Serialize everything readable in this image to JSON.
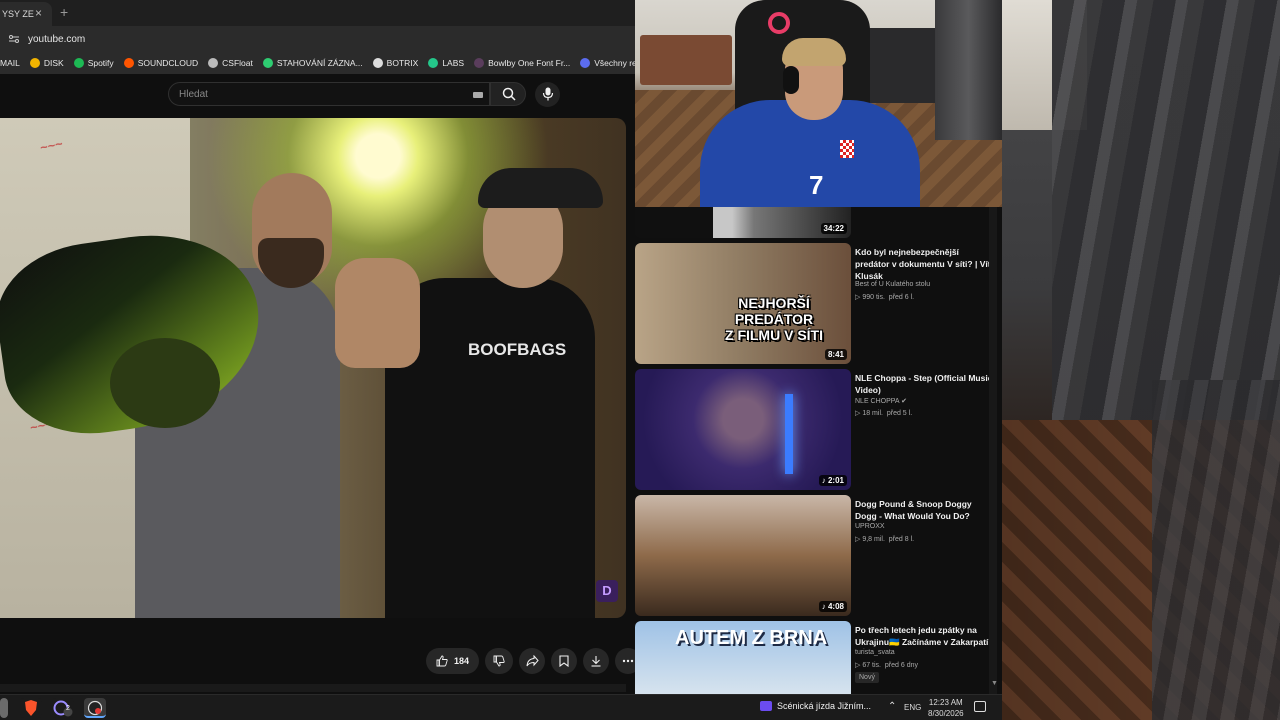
{
  "browser": {
    "tab_title": "YSY ZE",
    "new_tab_glyph": "+",
    "close_glyph": "×",
    "url": "youtube.com",
    "bookmarks": [
      {
        "label": "MAIL",
        "icon": "mail-icon",
        "color": "#d93025"
      },
      {
        "label": "DISK",
        "icon": "drive-icon",
        "color": "#f2b400"
      },
      {
        "label": "Spotify",
        "icon": "spotify-icon",
        "color": "#1db954"
      },
      {
        "label": "SOUNDCLOUD",
        "icon": "soundcloud-icon",
        "color": "#ff5500"
      },
      {
        "label": "CSFloat",
        "icon": "csfloat-icon",
        "color": "#bbbbbb"
      },
      {
        "label": "STAHOVÁNÍ ZÁZNA...",
        "icon": "download-icon",
        "color": "#2ecc71"
      },
      {
        "label": "BOTRIX",
        "icon": "botrix-icon",
        "color": "#dddddd"
      },
      {
        "label": "LABS",
        "icon": "labs-icon",
        "color": "#24c78a"
      },
      {
        "label": "Bowlby One Font Fr...",
        "icon": "font-icon",
        "color": "#5a3d5c"
      },
      {
        "label": "Všechny recenze",
        "icon": "reviews-icon",
        "color": "#5b6cf0"
      }
    ]
  },
  "youtube": {
    "search_placeholder": "Hledat",
    "video_overlay_text": "BOOFBAGS",
    "badge_letter": "D",
    "like_count": "184"
  },
  "webcam": {
    "jersey_number": "7"
  },
  "recommendations": [
    {
      "title": "",
      "channel": "",
      "views": "",
      "age": "",
      "duration": "34:22",
      "new": ""
    },
    {
      "title": "Kdo byl nejnebezpečnější predátor v dokumentu V síti? | Vít Klusák",
      "channel": "Best of U Kulatého stolu",
      "views": "990 tis.",
      "age": "před 6 l.",
      "duration": "8:41",
      "overlay": "NEJHORŠÍ\nPREDÁTOR\nZ FILMU V SÍTI",
      "new": ""
    },
    {
      "title": "NLE Choppa - Step (Official Music Video)",
      "channel": "NLE CHOPPA",
      "views": "18 mil.",
      "age": "před 5 l.",
      "duration": "2:01",
      "new": ""
    },
    {
      "title": "Dogg Pound & Snoop Doggy Dogg - What Would You Do?",
      "channel": "UPROXX",
      "views": "9,8 mil.",
      "age": "před 8 l.",
      "duration": "4:08",
      "new": ""
    },
    {
      "title": "Po třech letech jedu zpátky na Ukrajinu🇺🇦 Začínáme v Zakarpatí",
      "channel": "turista_svata",
      "views": "67 tis.",
      "age": "před 6 dny",
      "duration": "",
      "overlay": "AUTEM Z BRNA",
      "new": "Nový"
    }
  ],
  "taskbar": {
    "media_title": "Scénická jízda Jižním...",
    "language": "ENG",
    "time": "12:23 AM",
    "date": "8/30/2026",
    "badge_count": "2"
  }
}
